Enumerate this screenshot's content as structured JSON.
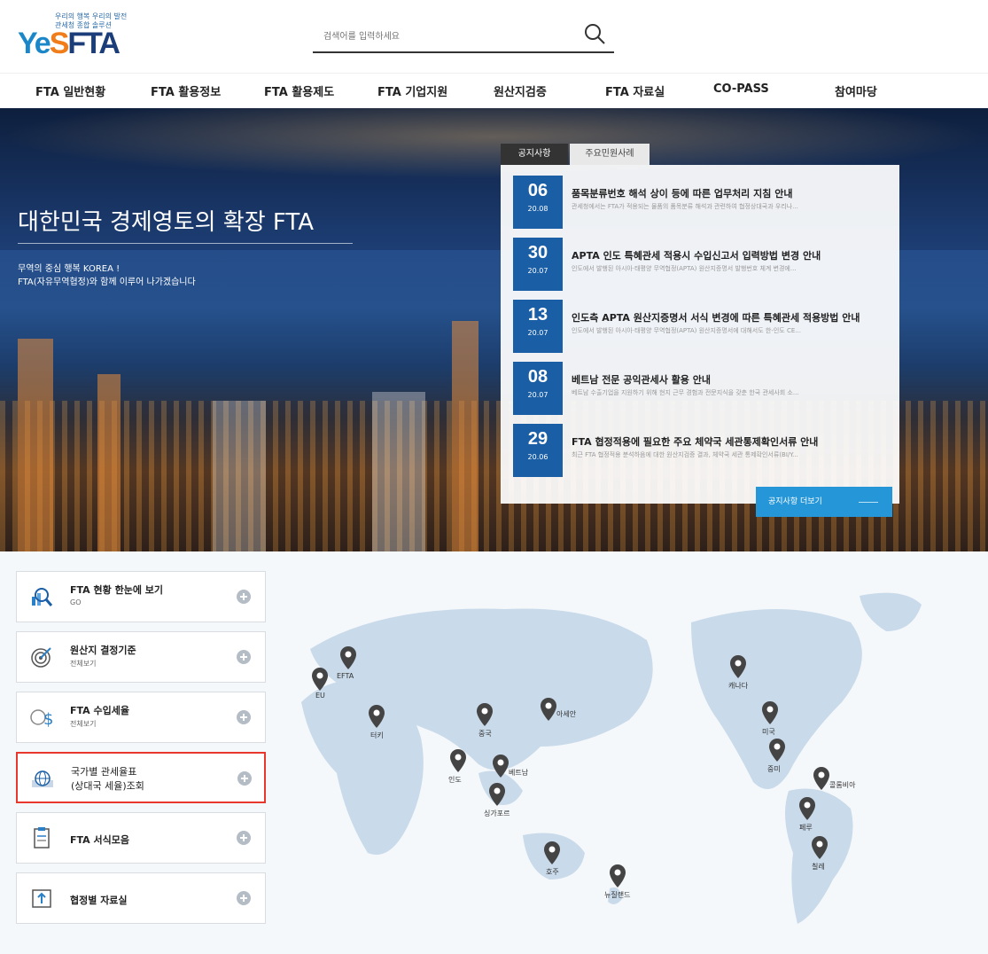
{
  "header": {
    "logo_slogan": "우리의 행복 우리의 발전\n관세청 종합 솔루션",
    "logo_ye": "Ye",
    "logo_s": "S",
    "logo_fta": "FTA",
    "search_placeholder": "검색어를 입력하세요"
  },
  "nav": {
    "items": [
      "FTA 일반현황",
      "FTA 활용정보",
      "FTA 활용제도",
      "FTA 기업지원",
      "원산지검증",
      "FTA 자료실",
      "CO-PASS",
      "참여마당"
    ]
  },
  "hero": {
    "title": "대한민국 경제영토의 확장 FTA",
    "sub1": "무역의 중심 행복 KOREA !",
    "sub2": "FTA(자유무역협정)와 함께 이루어 나가겠습니다"
  },
  "notices": {
    "tabs": [
      "공지사항",
      "주요민원사례"
    ],
    "items": [
      {
        "day": "06",
        "ym": "20.08",
        "title": "품목분류번호 해석 상이 등에 따른 업무처리 지침 안내",
        "desc": "관세청에서는 FTA가 적용되는 물품의 품목분류 해석과 관련하여 협정상대국과 우리나..."
      },
      {
        "day": "30",
        "ym": "20.07",
        "title": "APTA 인도 특혜관세 적용시 수입신고서 입력방법 변경 안내",
        "desc": "인도에서 발행된 아시아·태평양 무역협정(APTA) 원산지증명서 발행번호 체계 변경에..."
      },
      {
        "day": "13",
        "ym": "20.07",
        "title": "인도측 APTA 원산지증명서 서식 변경에 따른 특혜관세 적용방법 안내",
        "desc": "인도에서 발행된 아시아·태평양 무역협정(APTA) 원산지증명서에 대해서도 한-인도 CE..."
      },
      {
        "day": "08",
        "ym": "20.07",
        "title": "베트남 전문 공익관세사 활용 안내",
        "desc": "베트남 수출기업을 지원하기 위해 현지 근무 경험과 전문지식을 갖춘 한국 관세사회 소..."
      },
      {
        "day": "29",
        "ym": "20.06",
        "title": "FTA 협정적용에 필요한 주요 체약국 세관통제확인서류 안내",
        "desc": "최근 FTA 협정적용 분석하음에 대한 원산지검증 결과, 체약국 세관 통제확인서류(BI/Y..."
      }
    ],
    "more": "공지사항 더보기"
  },
  "quick": [
    {
      "title": "FTA 현황 한눈에 보기",
      "sub": "GO",
      "icon": "search-chart-icon"
    },
    {
      "title": "원산지 결정기준",
      "sub": "전체보기",
      "icon": "target-icon"
    },
    {
      "title": "FTA 수입세율",
      "sub": "전체보기",
      "icon": "dollar-globe-icon"
    },
    {
      "line1": "국가별 관세율표",
      "line2": "(상대국 세율)조회",
      "icon": "globe-icon"
    },
    {
      "title": "FTA 서식모음",
      "icon": "clipboard-icon"
    },
    {
      "title": "협정별 자료실",
      "icon": "upload-icon"
    }
  ],
  "map": {
    "pins": [
      "EFTA",
      "EU",
      "터키",
      "중국",
      "아세안",
      "인도",
      "베트남",
      "싱가포르",
      "호주",
      "뉴질랜드",
      "캐나다",
      "미국",
      "중미",
      "콜롬비아",
      "페루",
      "칠레"
    ]
  },
  "colors": {
    "accent_blue": "#1a5ea6",
    "button_blue": "#2596d8",
    "highlight_red": "#e8372c"
  }
}
